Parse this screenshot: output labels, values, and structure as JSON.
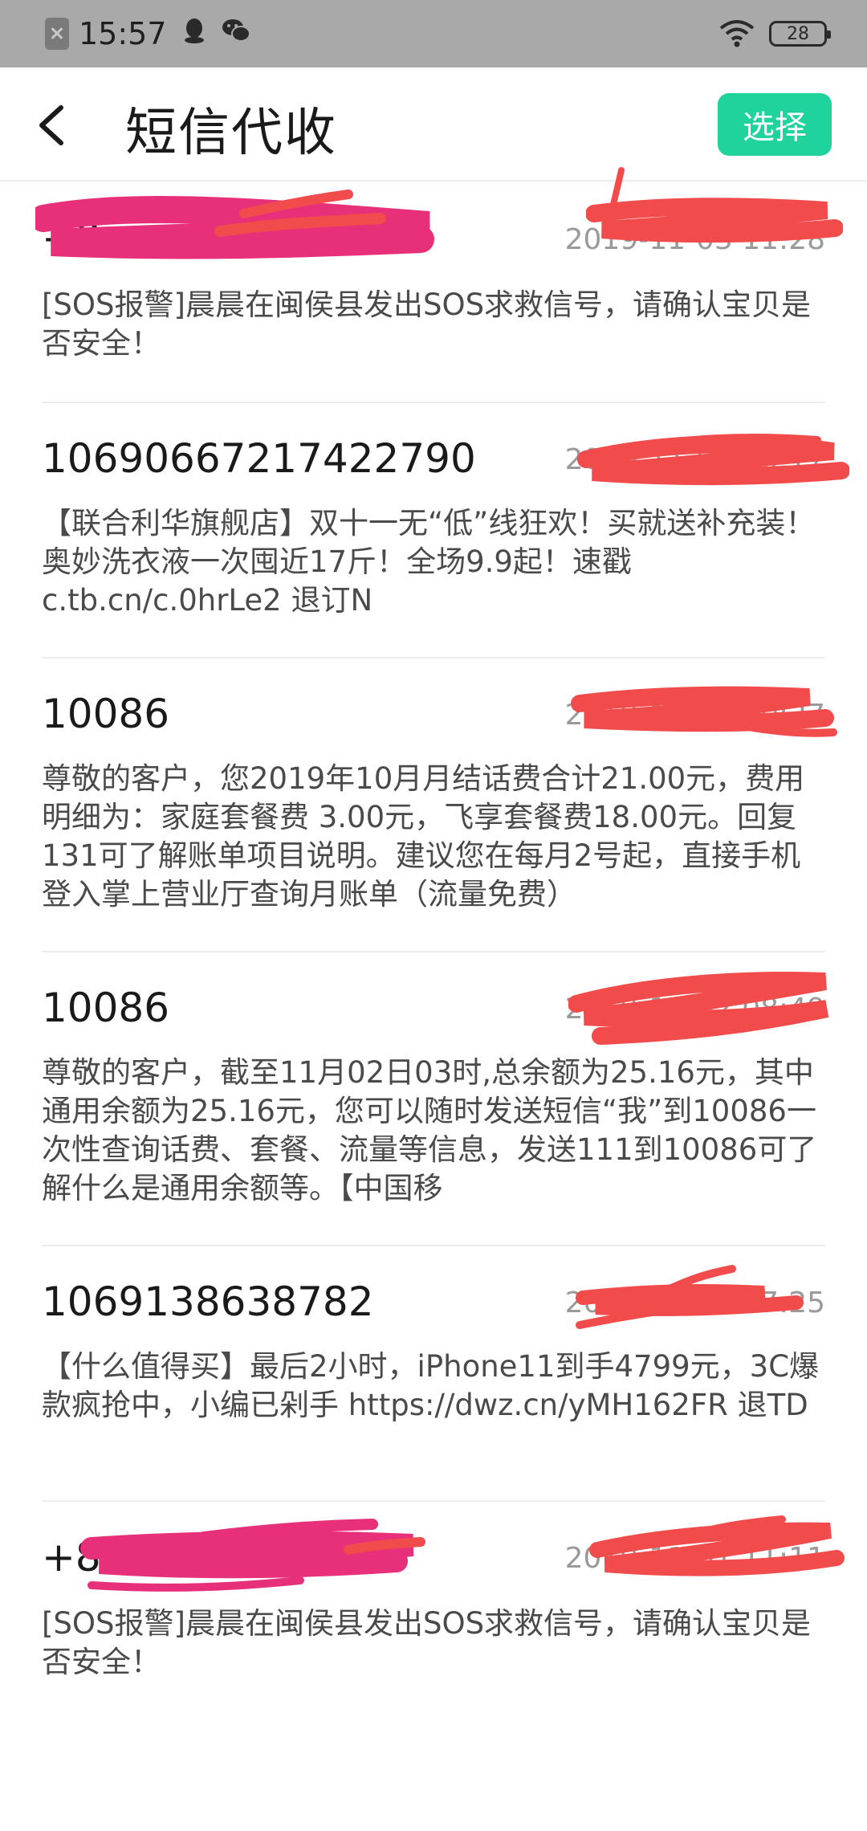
{
  "status_bar": {
    "time": "15:57",
    "battery": "28",
    "icons": [
      "sim-off-icon",
      "qq-icon",
      "wechat-icon",
      "wifi-icon",
      "battery-icon"
    ]
  },
  "header": {
    "title": "短信代收",
    "select_label": "选择",
    "accent_color": "#1fd39c"
  },
  "messages": [
    {
      "sender": "+8",
      "time": "2019-11-03 11:28",
      "body": "[SOS报警]晨晨在闽侯县发出SOS求救信号，请确认宝贝是否安全！"
    },
    {
      "sender": "10690667217422790",
      "time": "2019-11-02 20:17",
      "body": "【联合利华旗舰店】双十一无“低”线狂欢！买就送补充装！奥妙洗衣液一次囤近17斤！全场9.9起！速戳c.tb.cn/c.0hrLe2 退订N"
    },
    {
      "sender": "10086",
      "time": "2019-11-02 10:27",
      "body": "尊敬的客户，您2019年10月月结话费合计21.00元，费用明细为：家庭套餐费 3.00元，飞享套餐费18.00元。回复131可了解账单项目说明。建议您在每月2号起，直接手机登入掌上营业厅查询月账单（流量免费）"
    },
    {
      "sender": "10086",
      "time": "2019-11-02 08:49",
      "body": "尊敬的客户，截至11月02日03时,总余额为25.16元，其中通用余额为25.16元，您可以随时发送短信“我”到10086一次性查询话费、套餐、流量等信息，发送111到10086可了解什么是通用余额等。【中国移"
    },
    {
      "sender": "1069138638782",
      "time": "2019-11-01 17:25",
      "body": "【什么值得买】最后2小时，iPhone11到手4799元，3C爆款疯抢中，小编已剁手 https://dwz.cn/yMH162FR 退TD"
    },
    {
      "sender": "+8",
      "time": "2019-11-01 11:11",
      "body": "[SOS报警]晨晨在闽侯县发出SOS求救信号，请确认宝贝是否安全！"
    }
  ]
}
